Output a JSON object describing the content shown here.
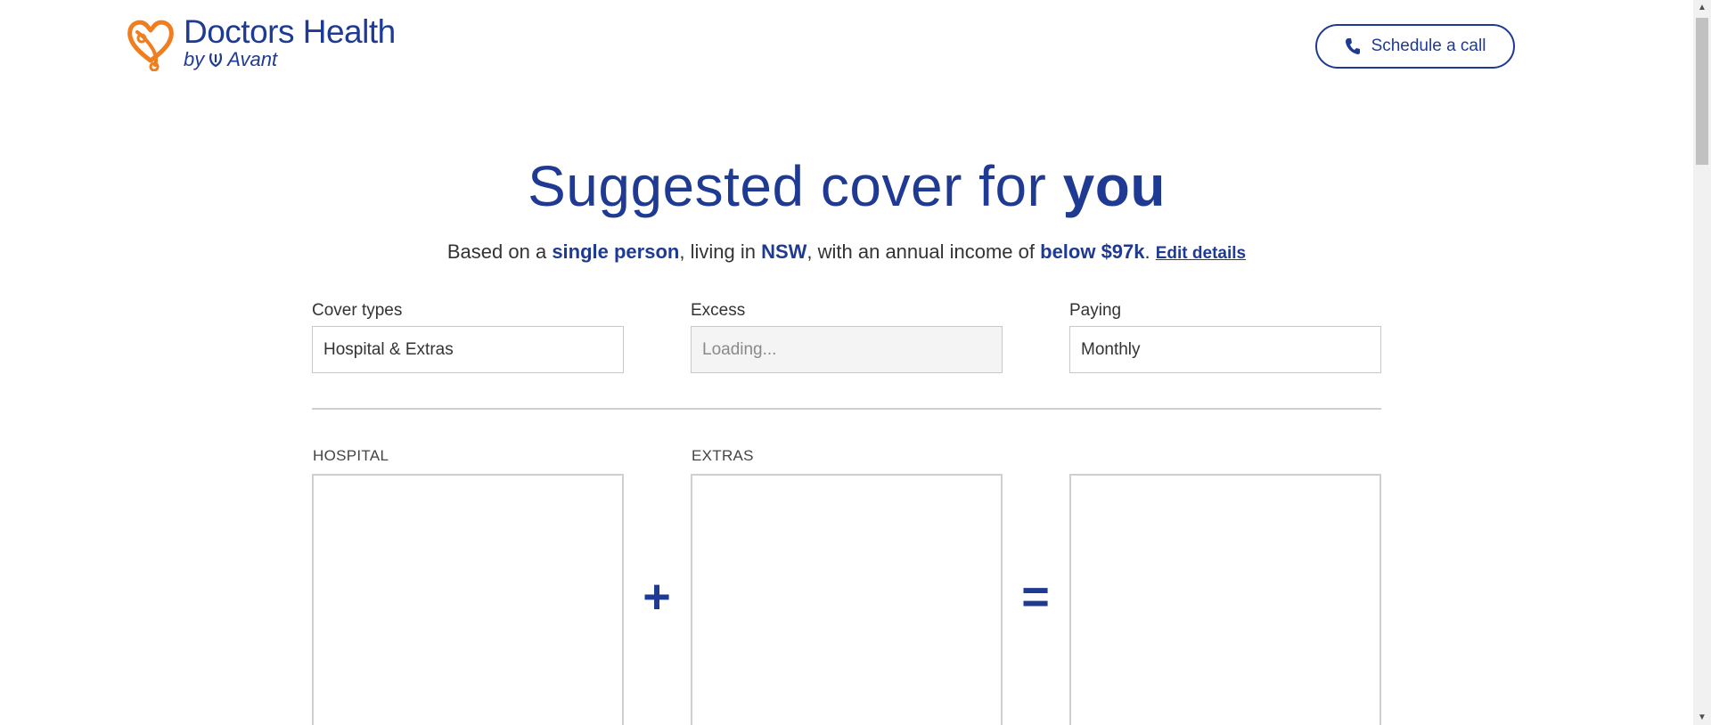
{
  "brand": {
    "name": "Doctors Health",
    "sub_prefix": "by",
    "sub_name": "Avant"
  },
  "header": {
    "schedule_label": "Schedule a call"
  },
  "hero": {
    "title_regular": "Suggested cover for ",
    "title_bold": "you",
    "sub_part1": "Based on a ",
    "sub_person": "single person",
    "sub_part2": ", living in ",
    "sub_state": "NSW",
    "sub_part3": ", with an annual income of ",
    "sub_income": "below $97k",
    "sub_part4": ". ",
    "edit_label": "Edit details"
  },
  "filters": {
    "cover": {
      "label": "Cover types",
      "value": "Hospital & Extras"
    },
    "excess": {
      "label": "Excess",
      "value": "Loading..."
    },
    "paying": {
      "label": "Paying",
      "value": "Monthly"
    }
  },
  "columns": {
    "hospital_label": "HOSPITAL",
    "extras_label": "EXTRAS",
    "plus": "+",
    "equals": "="
  },
  "colors": {
    "brand_blue": "#1f3a93",
    "brand_orange": "#f07d1e"
  }
}
